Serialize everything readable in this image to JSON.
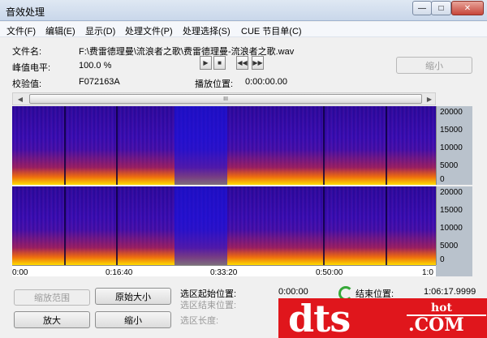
{
  "window": {
    "title": "音效处理"
  },
  "menu": [
    "文件(F)",
    "编辑(E)",
    "显示(D)",
    "处理文件(P)",
    "处理选择(S)",
    "CUE 节目单(C)"
  ],
  "file": {
    "label": "文件名:",
    "value": "F:\\费雷德理曼\\流浪者之歌\\费雷德理曼-流浪者之歌.wav"
  },
  "peak": {
    "label": "峰值电平:",
    "value": "100.0 %"
  },
  "checksum": {
    "label": "校验值:",
    "value": "F072163A"
  },
  "playback": {
    "label": "播放位置:",
    "value": "0:00:00.00"
  },
  "transport": [
    "play-icon",
    "stop-icon",
    "rewind-icon",
    "fast-forward-icon"
  ],
  "shrink_top": "缩小",
  "scroll": {
    "thumb_grip": "III"
  },
  "y_ticks": [
    "20000",
    "15000",
    "10000",
    "5000",
    "0"
  ],
  "time_ticks": [
    "0:00",
    "0:16:40",
    "0:33:20",
    "0:50:00",
    "1:0"
  ],
  "buttons": {
    "zoom_range": "缩放范围",
    "original_size": "原始大小",
    "zoom_in": "放大",
    "zoom_out": "缩小"
  },
  "selection": {
    "start_label": "选区起始位置:",
    "start_value": "0:00:00",
    "end_label": "选区结束位置:",
    "length_label": "选区长度:",
    "file_end_label": "结束位置:",
    "file_end_value": "1:06:17.9999"
  },
  "watermark": {
    "brand": "dts",
    "hot": "hot",
    "domain": ".COM"
  }
}
